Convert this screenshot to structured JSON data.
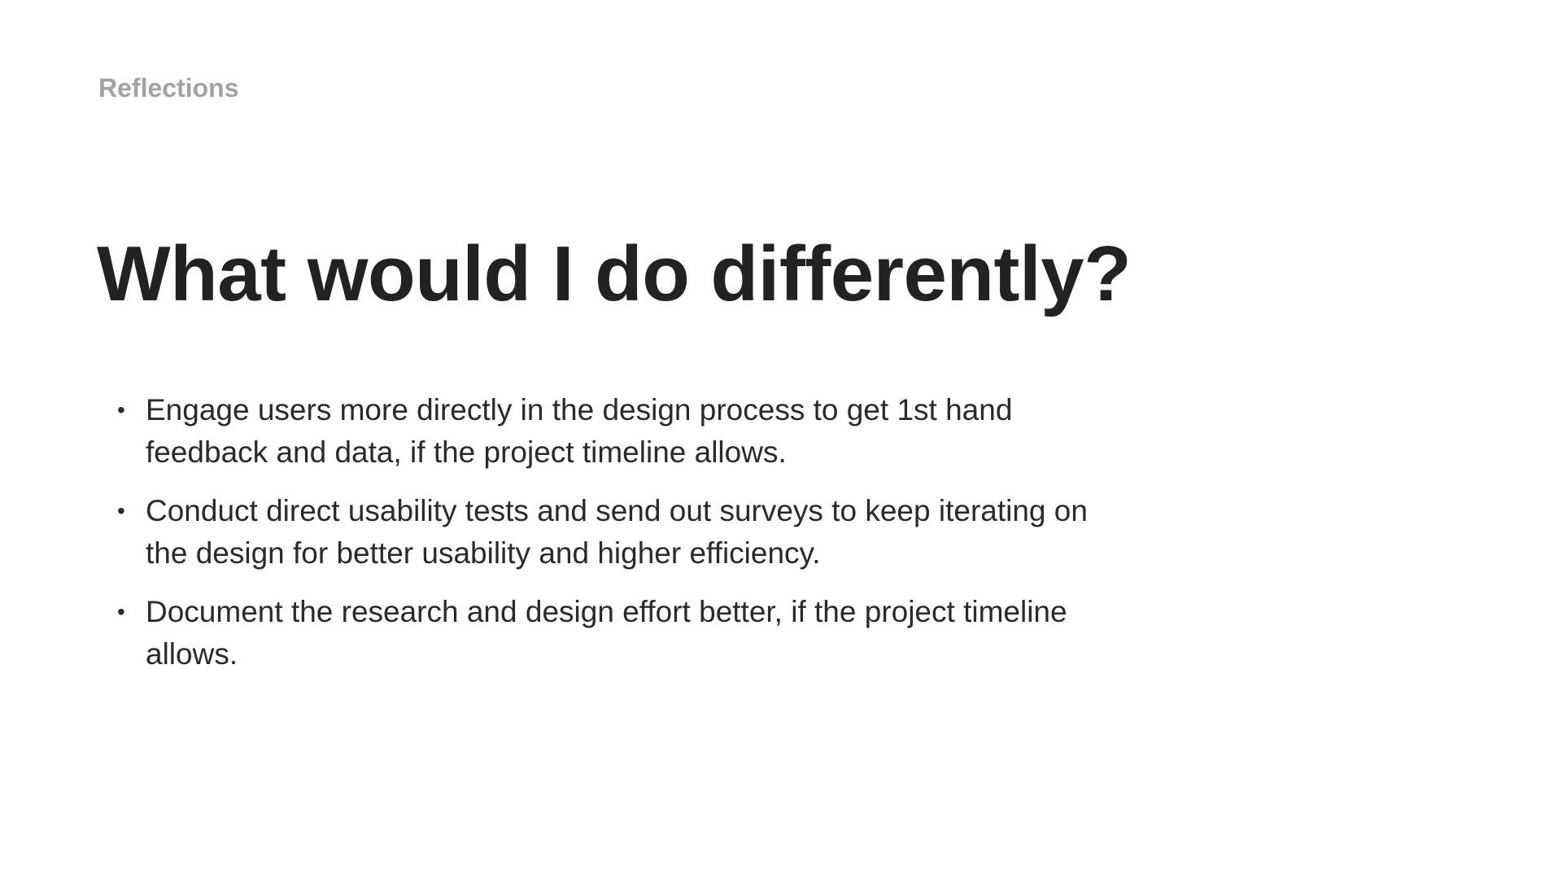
{
  "slide": {
    "eyebrow": "Reflections",
    "title": "What would I do differently?",
    "bullet_symbol": "•",
    "bullets": [
      "Engage users more directly in the design process to get 1st hand feedback and data, if the project timeline allows.",
      "Conduct direct usability tests and send out surveys to keep iterating on the design for better usability and higher efficiency.",
      "Document the research and design effort better, if the project timeline allows."
    ]
  },
  "colors": {
    "background": "#ffffff",
    "eyebrow": "#a3a3a3",
    "title": "#222222",
    "body": "#2a2a2a"
  }
}
